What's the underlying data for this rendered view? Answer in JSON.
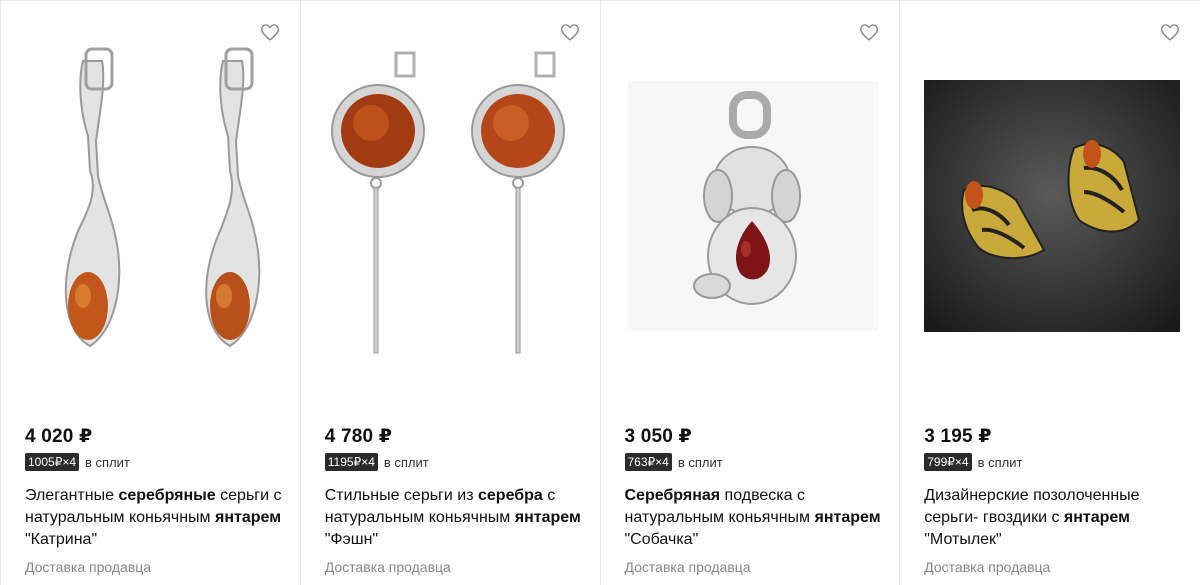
{
  "products": [
    {
      "price": "4 020 ₽",
      "split_badge": "1005₽×4",
      "split_label": "в сплит",
      "title": {
        "pre": "Элегантные ",
        "bold1": "серебряные",
        "mid": " серьги с натуральным коньячным ",
        "bold2": "янтарем",
        "post": " \"Катрина\""
      },
      "delivery": "Доставка продавца",
      "favorite_icon": "heart-outline-icon"
    },
    {
      "price": "4 780 ₽",
      "split_badge": "1195₽×4",
      "split_label": "в сплит",
      "title": {
        "pre": "Стильные серьги из ",
        "bold1": "серебра",
        "mid": " с натуральным коньячным ",
        "bold2": "янтарем",
        "post": " \"Фэшн\""
      },
      "delivery": "Доставка продавца",
      "favorite_icon": "heart-outline-icon"
    },
    {
      "price": "3 050 ₽",
      "split_badge": "763₽×4",
      "split_label": "в сплит",
      "title": {
        "pre": "",
        "bold1": "Серебряная",
        "mid": " подвеска с натуральным коньячным ",
        "bold2": "янтарем",
        "post": " \"Собачка\""
      },
      "delivery": "Доставка продавца",
      "favorite_icon": "heart-outline-icon"
    },
    {
      "price": "3 195 ₽",
      "split_badge": "799₽×4",
      "split_label": "в сплит",
      "title": {
        "pre": "Дизайнерские позолоченные серьги- гвоздики с ",
        "bold1": "янтарем",
        "mid": " \"Мотылек\"",
        "bold2": "",
        "post": ""
      },
      "delivery": "Доставка продавца",
      "favorite_icon": "heart-outline-icon"
    }
  ],
  "colors": {
    "amber": "#c2571b",
    "silver": "#d9d9d9",
    "split_badge_bg": "#2b2b2b"
  }
}
